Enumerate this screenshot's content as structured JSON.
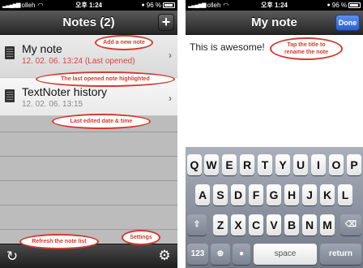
{
  "status": {
    "carrier": "olleh",
    "time": "오후 1:24",
    "battery": "96 %"
  },
  "left": {
    "title": "Notes (2)",
    "add_label": "+",
    "notes": [
      {
        "title": "My note",
        "date": "12. 02. 06. 13:24 (Last opened)"
      },
      {
        "title": "TextNoter history",
        "date": "12. 02. 06. 13:15"
      }
    ],
    "callouts": {
      "add": "Add a new note",
      "highlight": "The last opened note highlighted",
      "date": "Last edited date & time",
      "refresh": "Refresh the note list",
      "settings": "Settings"
    }
  },
  "right": {
    "title": "My note",
    "done_label": "Done",
    "body_text": "This is awesome!",
    "callout_title": "Tap the title to rename the note",
    "keyboard": {
      "row1": [
        "Q",
        "W",
        "E",
        "R",
        "T",
        "Y",
        "U",
        "I",
        "O",
        "P"
      ],
      "row2": [
        "A",
        "S",
        "D",
        "F",
        "G",
        "H",
        "J",
        "K",
        "L"
      ],
      "row3": [
        "Z",
        "X",
        "C",
        "V",
        "B",
        "N",
        "M"
      ],
      "num_label": "123",
      "space_label": "space",
      "return_label": "return"
    }
  }
}
